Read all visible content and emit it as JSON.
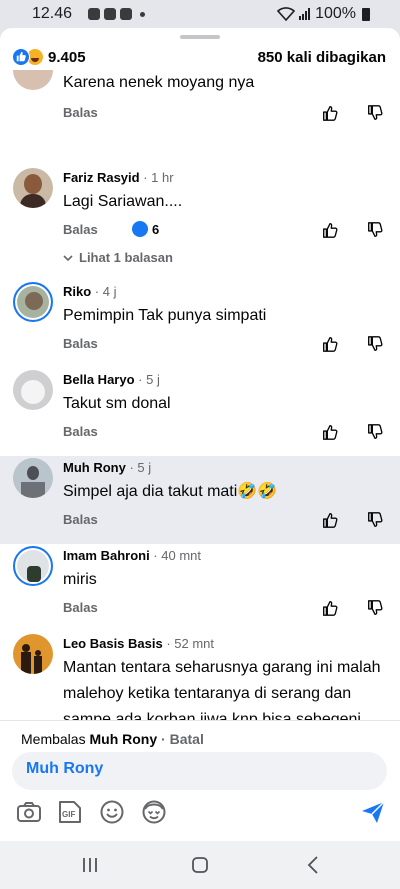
{
  "status_bar": {
    "time": "12.46",
    "battery": "100%",
    "notification_icons": [
      "facebook-icon",
      "message-icon",
      "tiktok-icon"
    ]
  },
  "header": {
    "reaction_count": "9.405",
    "share_count": "850 kali dibagikan",
    "reactions": [
      "like-icon",
      "haha-icon"
    ]
  },
  "colors": {
    "accent": "#1877f2",
    "text": "#050505",
    "muted": "#65676b",
    "highlight": "#e9ebf1"
  },
  "comments": [
    {
      "author": "",
      "time": "",
      "text": "Karena nenek moyang nya",
      "reply_label": "Balas"
    },
    {
      "author": "Fariz Rasyid",
      "time": "1 hr",
      "text": "Lagi Sariawan....",
      "reply_label": "Balas",
      "like_count": "6",
      "view_replies": "Lihat 1 balasan"
    },
    {
      "author": "Riko",
      "time": "4 j",
      "text": "Pemimpin Tak punya simpati",
      "reply_label": "Balas"
    },
    {
      "author": "Bella Haryo",
      "time": "5 j",
      "text": "Takut sm donal",
      "reply_label": "Balas"
    },
    {
      "author": "Muh Rony",
      "time": "5 j",
      "text": "Simpel aja dia takut mati🤣🤣",
      "reply_label": "Balas"
    },
    {
      "author": "Imam Bahroni",
      "time": "40 mnt",
      "text": "miris",
      "reply_label": "Balas"
    },
    {
      "author": "Leo Basis Basis",
      "time": "52 mnt",
      "text": "Mantan tentara seharusnya garang ini malah malehoy ketika tentaranya di serang dan sampe ada korban jiwa knp bisa sebegeni negriku😥"
    }
  ],
  "composer": {
    "replying_prefix": "Membalas",
    "replying_to": "Muh Rony",
    "separator": "·",
    "cancel_label": "Batal",
    "input_value": "Muh Rony",
    "tools": [
      "camera-icon",
      "gif-icon",
      "emoji-icon",
      "avatar-sticker-icon",
      "send-icon"
    ]
  }
}
